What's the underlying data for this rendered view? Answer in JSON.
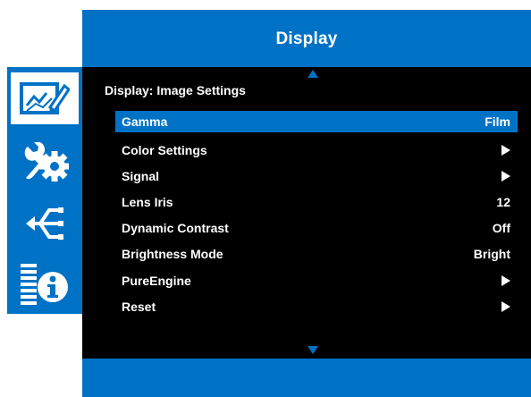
{
  "header": {
    "title": "Display"
  },
  "section": {
    "title": "Display: Image Settings"
  },
  "sidebar": {
    "items": [
      {
        "icon": "display-chart-icon",
        "selected": true
      },
      {
        "icon": "tools-gear-icon",
        "selected": false
      },
      {
        "icon": "network-share-icon",
        "selected": false
      },
      {
        "icon": "info-icon",
        "selected": false
      }
    ]
  },
  "menu": {
    "items": [
      {
        "label": "Gamma",
        "value": "Film",
        "selected": true
      },
      {
        "label": "Color Settings",
        "value": "",
        "submenu": true
      },
      {
        "label": "Signal",
        "value": "",
        "submenu": true
      },
      {
        "label": "Lens Iris",
        "value": "12"
      },
      {
        "label": "Dynamic Contrast",
        "value": "Off"
      },
      {
        "label": "Brightness Mode",
        "value": "Bright"
      },
      {
        "label": "PureEngine",
        "value": "",
        "submenu": true
      },
      {
        "label": "Reset",
        "value": "",
        "submenu": true
      }
    ]
  },
  "colors": {
    "accent": "#0072c6",
    "panel": "#000000",
    "text": "#ffffff"
  }
}
